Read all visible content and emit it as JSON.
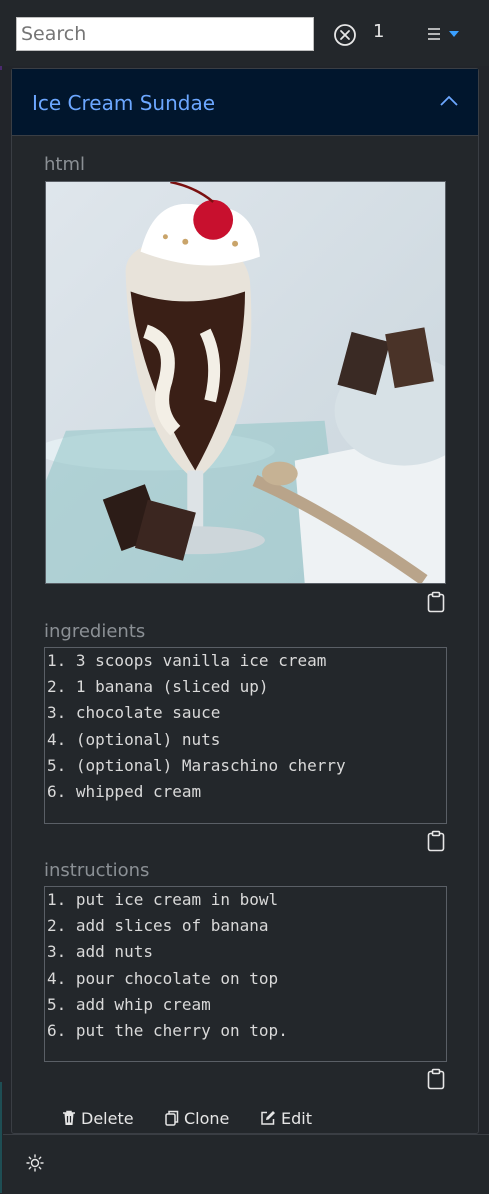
{
  "search": {
    "placeholder": "Search",
    "value": ""
  },
  "result_count": "1",
  "icons": {
    "clear": "clear-circle-x-icon",
    "menu": "hamburger-caret-icon",
    "collapse": "chevron-up-icon",
    "copy": "clipboard-icon",
    "delete": "trash-icon",
    "clone": "copy-icon",
    "edit": "pencil-square-icon",
    "theme": "sun-icon"
  },
  "colors": {
    "accent": "#3aa0ff",
    "header_bg": "#01162d",
    "title": "#6ca7ff",
    "panel_bg": "#23272b"
  },
  "recipe": {
    "title": "Ice Cream Sundae",
    "image_label": "html",
    "ingredients_label": "ingredients",
    "ingredients": [
      "1. 3 scoops vanilla ice cream",
      "2. 1 banana (sliced up)",
      "3. chocolate sauce",
      "4. (optional) nuts",
      "5. (optional) Maraschino cherry",
      "6. whipped cream"
    ],
    "instructions_label": "instructions",
    "instructions": [
      "1. put ice cream in bowl",
      "2. add slices of banana",
      "3. add nuts",
      "4. pour chocolate on top",
      "5. add whip cream",
      "6. put the cherry on top."
    ]
  },
  "actions": {
    "delete": "Delete",
    "clone": "Clone",
    "edit": "Edit"
  }
}
